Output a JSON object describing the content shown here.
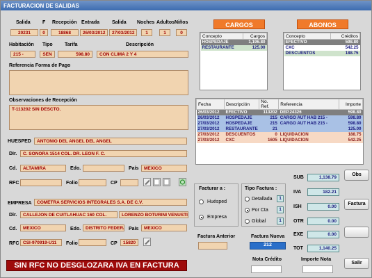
{
  "window": {
    "title": "FACTURACION DE SALIDAS"
  },
  "stay": {
    "headers": {
      "salida": "Salida",
      "f": "F",
      "recepcion": "Recepción",
      "entrada": "Entrada",
      "salida2": "Salida",
      "noches": "Noches",
      "adultos": "Adultos",
      "ninos": "Niños"
    },
    "values": {
      "salida": "20231",
      "f": "0",
      "recepcion": "18868",
      "entrada": "26/03/2012",
      "salida2": "27/03/2012",
      "noches": "1",
      "adultos": "1",
      "ninos": "0"
    },
    "row2_headers": {
      "habitacion": "Habitación",
      "tipo": "Tipo",
      "tarifa": "Tarifa",
      "descripcion": "Descripción"
    },
    "row2_values": {
      "habitacion": "215 -",
      "tipo": "SEN",
      "tarifa": "598.80",
      "descripcion": "CON CLIMA 2 Y 4"
    },
    "ref_label": "Referencia Forma de Pago",
    "ref_value": "",
    "obs_label": "Observaciones de Recepción",
    "obs_value": "T-113202  SIN DESCTO."
  },
  "cargos": {
    "title": "CARGOS",
    "headers": [
      "Concepto",
      "Cargos"
    ],
    "rows": [
      {
        "concepto": "HOSPEDAJE",
        "monto": "1,196.80",
        "style": "sel"
      },
      {
        "concepto": "RESTAURANTE",
        "monto": "125.00",
        "style": "grn"
      }
    ]
  },
  "abonos": {
    "title": "ABONOS",
    "headers": [
      "Concepto",
      "Créditos"
    ],
    "rows": [
      {
        "concepto": "EFECTIVO",
        "monto": "598.80",
        "style": "sel"
      },
      {
        "concepto": "CXC",
        "monto": "542.25",
        "style": ""
      },
      {
        "concepto": "DESCUENTOS",
        "monto": "188.75",
        "style": "grn"
      }
    ]
  },
  "movimientos": {
    "headers": [
      "Fecha",
      "Descripción",
      "No. Ref.",
      "Referencia",
      "Importe"
    ],
    "rows": [
      {
        "fecha": "26/03/2012",
        "desc": "EFECTIVO",
        "ref": "113202",
        "referencia": "DEP.24326",
        "importe": "598.80",
        "style": "sel"
      },
      {
        "fecha": "26/03/2012",
        "desc": "HOSPEDAJE",
        "ref": "215",
        "referencia": "CARGO AUT HAB 215 -",
        "importe": "598.80",
        "style": "blue"
      },
      {
        "fecha": "27/03/2012",
        "desc": "HOSPEDAJE",
        "ref": "215",
        "referencia": "CARGO AUT HAB 215 -",
        "importe": "598.80",
        "style": "blue"
      },
      {
        "fecha": "27/03/2012",
        "desc": "RESTAURANTE",
        "ref": "21",
        "referencia": "",
        "importe": "125.00",
        "style": "blue"
      },
      {
        "fecha": "27/03/2012",
        "desc": "DESCUENTOS",
        "ref": "0",
        "referencia": "LIQUIDACION",
        "importe": "188.75",
        "style": "pink"
      },
      {
        "fecha": "27/03/2012",
        "desc": "CXC",
        "ref": "1605",
        "referencia": "LIQUIDACION",
        "importe": "542.25",
        "style": "pink"
      }
    ]
  },
  "huesped": {
    "section": "HUESPED",
    "name": "ANTONIO DEL ANGEL DEL ANGEL",
    "dir_label": "Dir.",
    "dir": "C. SONORA 1514 COL. DR. LEON F. C.",
    "cd_label": "Cd.",
    "cd": "ALTAMIRA",
    "edo_label": "Edo.",
    "edo": "",
    "pais_label": "País",
    "pais": "MEXICO",
    "rfc_label": "RFC",
    "rfc": "",
    "folio_label": "Folio",
    "folio": "",
    "cp_label": "CP",
    "cp": ""
  },
  "empresa": {
    "section": "EMPRESA",
    "name": "COMETRA SERVICIOS INTEGRALES S.A. DE C.V.",
    "dir_label": "Dir.",
    "dir": "CALLEJON DE CUITLAHUAC 160 COL.",
    "dir2": "LORENZO BOTURINI VENUSTIA",
    "cd_label": "Cd.",
    "cd": "MEXICO",
    "edo_label": "Edo.",
    "edo": "DISTRITO FEDERAL",
    "pais_label": "País",
    "pais": "MEXICO",
    "rfc_label": "RFC",
    "rfc": "CSI-970919-U11",
    "folio_label": "Folio",
    "folio": "",
    "cp_label": "CP",
    "cp": "15820"
  },
  "facturar": {
    "label": "Facturar a :",
    "huesped": "Huésped",
    "empresa": "Empresa",
    "selected": "empresa"
  },
  "tipo_factura": {
    "label": "Tipo Factura :",
    "detallada": "Detallada",
    "detallada_n": "1",
    "porcta": "Por Cta",
    "porcta_n": "1",
    "global": "Global",
    "global_n": "1",
    "selected": "porcta"
  },
  "factura_anterior": {
    "label": "Factura Anterior",
    "value": ""
  },
  "factura_nueva": {
    "label": "Factura Nueva",
    "value": "212"
  },
  "totals": [
    {
      "label": "SUB",
      "value": "1,138.79"
    },
    {
      "label": "IVA",
      "value": "182.21"
    },
    {
      "label": "ISH",
      "value": "0.00"
    },
    {
      "label": "OTR",
      "value": "0.00"
    },
    {
      "label": "EXE",
      "value": "0.00"
    },
    {
      "label": "TOT",
      "value": "1,140.25"
    }
  ],
  "buttons": {
    "obs": "Obs",
    "factura": "Factura",
    "salir": "Salir"
  },
  "nota_credito": {
    "label": "Nota Crédito",
    "value": ""
  },
  "importe_nota": {
    "label": "Importe Nota",
    "value": ""
  },
  "warning": "SIN RFC NO DESGLOZARA IVA EN FACTURA",
  "colors": {
    "field": "#f1d4b0",
    "accent": "#f07a2a",
    "warning": "#9e0b0b",
    "selected": "#7f7f7f"
  }
}
